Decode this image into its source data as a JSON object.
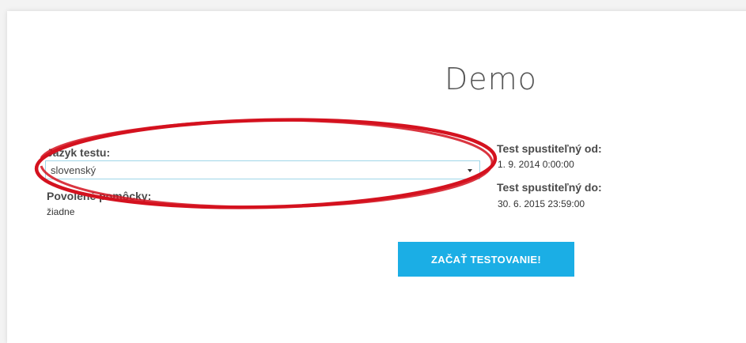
{
  "page": {
    "title": "Demo"
  },
  "language": {
    "label": "Jazyk testu:",
    "selected": "slovenský"
  },
  "aids": {
    "label": "Povolené pomôcky:",
    "value": "žiadne"
  },
  "schedule": {
    "from_label": "Test spustiteľný od:",
    "from_value": "1. 9. 2014 0:00:00",
    "to_label": "Test spustiteľný do:",
    "to_value": "30. 6. 2015 23:59:00"
  },
  "actions": {
    "start_label": "ZAČAŤ TESTOVANIE!"
  },
  "colors": {
    "accent": "#1baee5",
    "annotation": "#d4121f"
  },
  "icons": {
    "select_caret": "chevron-down-icon"
  }
}
